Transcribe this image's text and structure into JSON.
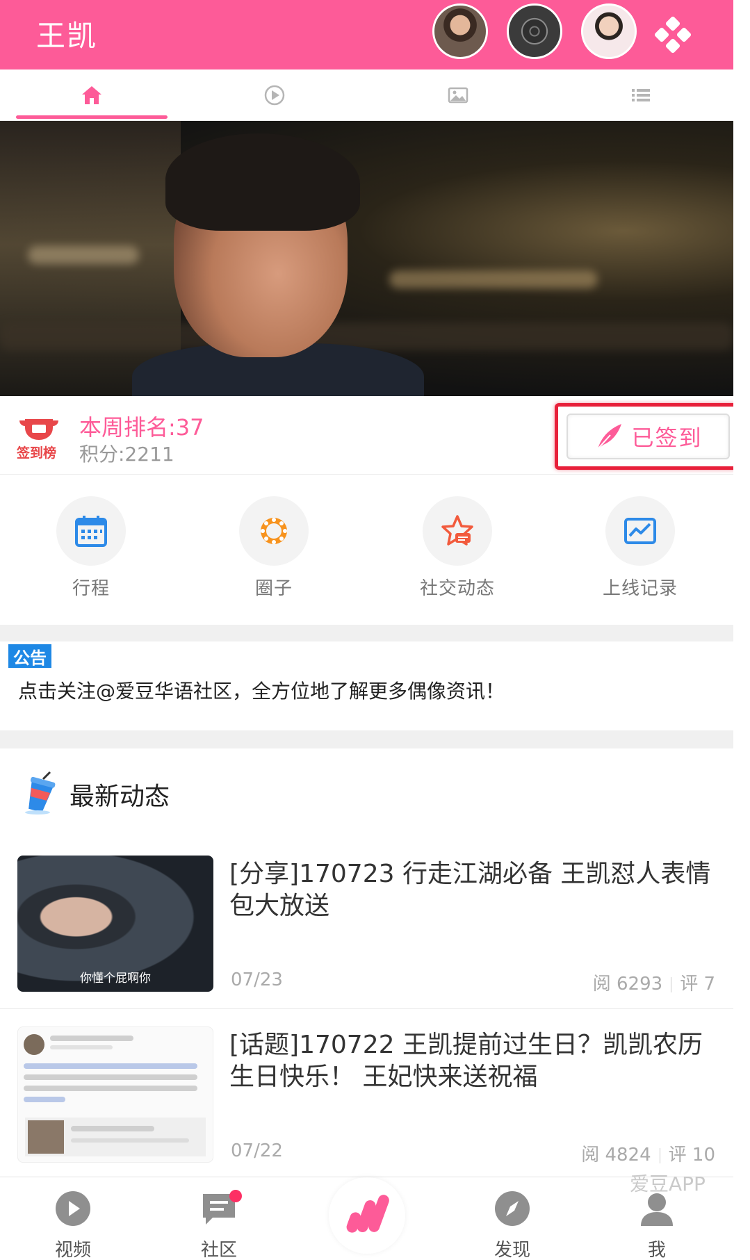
{
  "header": {
    "title": "王凯",
    "accent_color": "#fd5b98"
  },
  "tabs": [
    {
      "icon": "home-icon",
      "active": true
    },
    {
      "icon": "play-circle-icon",
      "active": false
    },
    {
      "icon": "image-icon",
      "active": false
    },
    {
      "icon": "list-icon",
      "active": false
    }
  ],
  "signin": {
    "badge_label": "签到榜",
    "rank_text": "本周排名:37",
    "score_text": "积分:2211",
    "button_label": "已签到"
  },
  "quick_menu": [
    {
      "label": "行程",
      "icon": "calendar-icon"
    },
    {
      "label": "圈子",
      "icon": "circle-icon"
    },
    {
      "label": "社交动态",
      "icon": "star-chat-icon"
    },
    {
      "label": "上线记录",
      "icon": "trend-chart-icon"
    }
  ],
  "notice": {
    "tag": "公告",
    "text": "点击关注@爱豆华语社区，全方位地了解更多偶像资讯！"
  },
  "latest": {
    "title": "最新动态",
    "items": [
      {
        "title": "[分享]170723 行走江湖必备 王凯怼人表情包大放送",
        "date": "07/23",
        "reads": "阅  6293",
        "comments": "评  7",
        "thumb_caption": "你懂个屁啊你"
      },
      {
        "title": "[话题]170722 王凯提前过生日？凯凯农历生日快乐！ 王妃快来送祝福",
        "date": "07/22",
        "reads": "阅  4824",
        "comments": "评  10"
      }
    ]
  },
  "bottom_nav": [
    {
      "label": "视频",
      "icon": "video-icon"
    },
    {
      "label": "社区",
      "icon": "community-icon"
    },
    {
      "label": "",
      "icon": "app-logo-icon"
    },
    {
      "label": "发现",
      "icon": "compass-icon"
    },
    {
      "label": "我",
      "icon": "user-icon"
    }
  ],
  "watermark": "爱豆APP"
}
